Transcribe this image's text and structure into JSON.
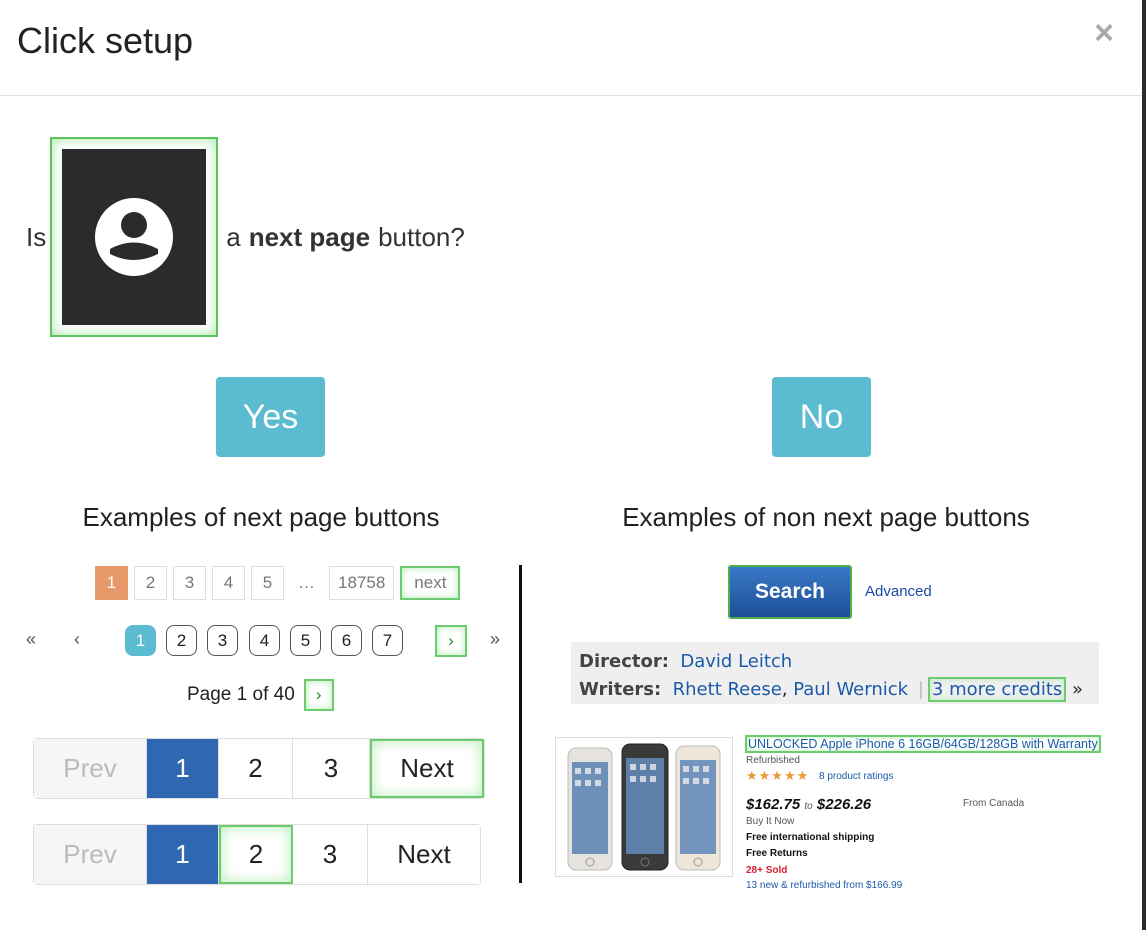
{
  "dialog": {
    "title": "Click setup",
    "close_glyph": "×"
  },
  "question": {
    "prefix": "Is",
    "middle": "a",
    "bold": "next page",
    "suffix": "button?"
  },
  "buttons": {
    "yes": "Yes",
    "no": "No"
  },
  "examples": {
    "positive_heading": "Examples of next page buttons",
    "negative_heading": "Examples of non next page buttons"
  },
  "pager1": {
    "pages": [
      "1",
      "2",
      "3",
      "4",
      "5",
      "…",
      "18758"
    ],
    "next": "next"
  },
  "pager2": {
    "first": "«",
    "prev": "‹",
    "pages": [
      "1",
      "2",
      "3",
      "4",
      "5",
      "6",
      "7"
    ],
    "next": "›",
    "last": "»"
  },
  "pager3": {
    "text": "Page 1 of 40",
    "next": "›"
  },
  "pager4": {
    "prev": "Prev",
    "pages": [
      "1",
      "2",
      "3"
    ],
    "next": "Next"
  },
  "pager5": {
    "prev": "Prev",
    "pages": [
      "1",
      "2",
      "3"
    ],
    "next": "Next"
  },
  "search_example": {
    "button": "Search",
    "link": "Advanced"
  },
  "credits_example": {
    "director_label": "Director:",
    "director": "David Leitch",
    "writers_label": "Writers:",
    "writer1": "Rhett Reese",
    "comma": ",",
    "writer2": "Paul Wernick",
    "sep": "|",
    "more": "3 more credits",
    "more_arrow": "»"
  },
  "listing_example": {
    "title": "UNLOCKED Apple iPhone 6 16GB/64GB/128GB with Warranty",
    "condition": "Refurbished",
    "stars": "★★★★★",
    "ratings": "8 product ratings",
    "price_low": "$162.75",
    "price_to": "to",
    "price_high": "$226.26",
    "origin": "From Canada",
    "format": "Buy It Now",
    "shipping": "Free international shipping",
    "returns": "Free Returns",
    "sold": "28+ Sold",
    "new_refurb": "13 new & refurbished from $166.99"
  },
  "icons": {
    "close": "close-icon",
    "avatar": "user-avatar-icon"
  },
  "colors": {
    "accent": "#5bbbd0",
    "highlight_green": "#6ccb6c",
    "pager_active_blue": "#2f67b2",
    "pager_active_orange": "#e8996a"
  }
}
